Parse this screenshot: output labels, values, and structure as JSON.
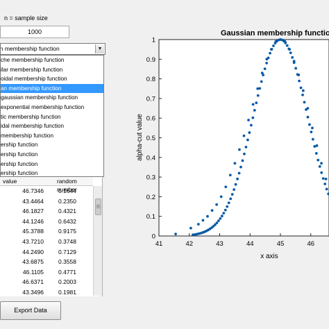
{
  "controls": {
    "sample_size_label": "n = sample size",
    "sample_size_value": "1000",
    "selected_function": "an membership function",
    "dropdown_arrow": "▼",
    "export_label": "Export Data"
  },
  "dropdown": {
    "items": [
      "che membership function",
      "ilar  membership function",
      "oidal membership function",
      "an membership function",
      " gaussian membership function",
      " exponential membership function",
      "tic membership function",
      "idal membership function",
      "  membership function",
      "ership function",
      "ership function",
      "ership function",
      "ership function"
    ],
    "selected_index": 3
  },
  "table": {
    "headers": [
      "value",
      "random number"
    ],
    "rows": [
      [
        "46.7346",
        "0.1644"
      ],
      [
        "43.4464",
        "0.2350"
      ],
      [
        "46.1827",
        "0.4321"
      ],
      [
        "44.1246",
        "0.6432"
      ],
      [
        "45.3788",
        "0.9175"
      ],
      [
        "43.7210",
        "0.3748"
      ],
      [
        "44.2490",
        "0.7129"
      ],
      [
        "43.6875",
        "0.3558"
      ],
      [
        "46.1105",
        "0.4771"
      ],
      [
        "46.6371",
        "0.2003"
      ],
      [
        "43.3496",
        "0.1981"
      ]
    ]
  },
  "chart_data": {
    "type": "scatter",
    "title": "Gaussian membership functio",
    "xlabel": "x axis",
    "ylabel": "alpha-cut value",
    "xlim": [
      41,
      46.6
    ],
    "ylim": [
      0,
      1
    ],
    "xticks": [
      "41",
      "42",
      "43",
      "44",
      "45",
      "46"
    ],
    "yticks": [
      "0",
      "0.1",
      "0.2",
      "0.3",
      "0.4",
      "0.5",
      "0.6",
      "0.7",
      "0.8",
      "0.9",
      "1"
    ],
    "series": [
      {
        "color": "#0a5aa6",
        "mean": 45,
        "sigma": 0.9,
        "x": [
          41.55,
          42.05,
          42.3,
          42.45,
          42.6,
          42.75,
          42.9,
          43.05,
          43.2,
          43.35,
          43.5,
          43.65,
          43.8,
          43.95,
          44.1,
          44.25,
          44.4,
          44.55,
          44.7,
          44.85,
          45.0,
          45.15,
          45.3,
          45.45,
          45.6,
          45.75,
          45.9,
          46.05,
          46.2,
          46.35,
          46.5
        ],
        "y": [
          0.01,
          0.04,
          0.06,
          0.08,
          0.1,
          0.13,
          0.16,
          0.2,
          0.25,
          0.31,
          0.37,
          0.44,
          0.51,
          0.59,
          0.67,
          0.75,
          0.83,
          0.9,
          0.95,
          0.99,
          1.0,
          0.99,
          0.95,
          0.89,
          0.82,
          0.74,
          0.65,
          0.55,
          0.46,
          0.37,
          0.29
        ]
      }
    ]
  }
}
